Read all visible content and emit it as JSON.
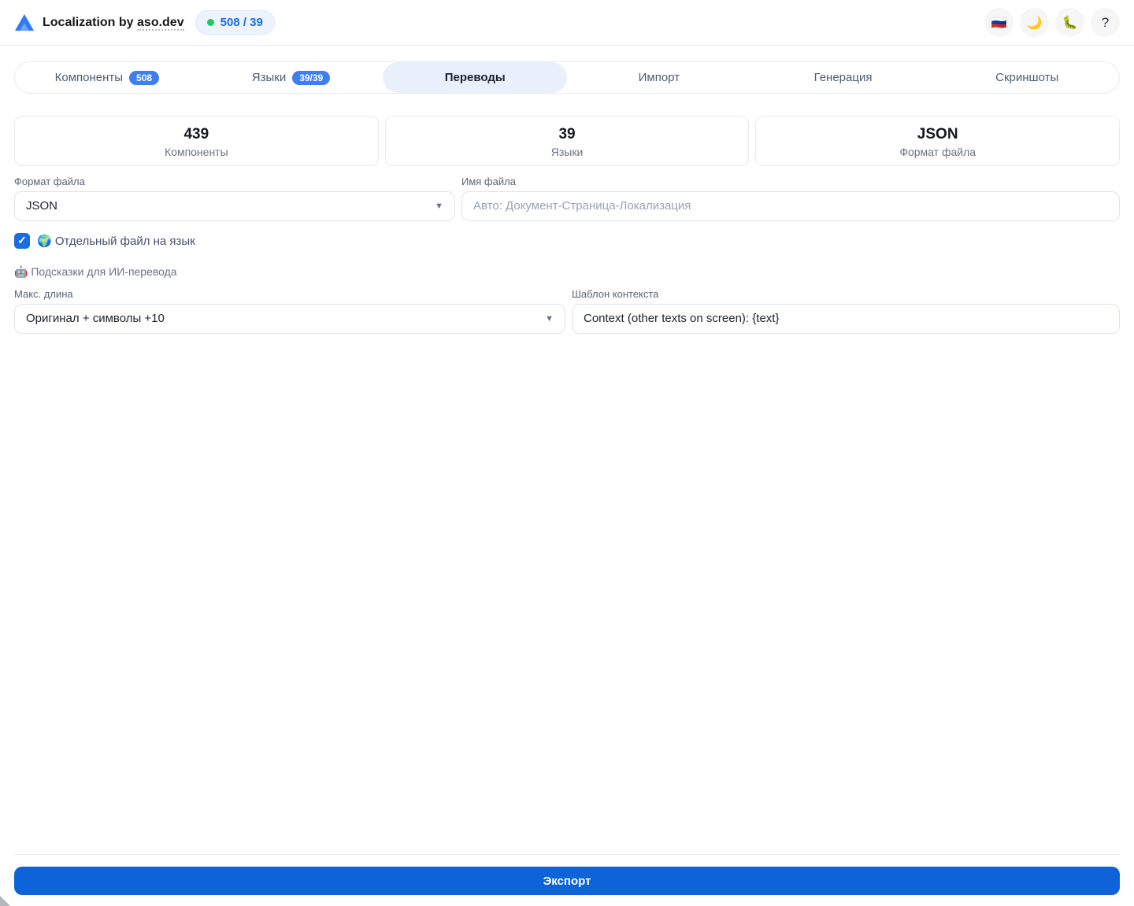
{
  "header": {
    "title_prefix": "Localization by ",
    "title_link": "aso.dev",
    "counter_badge": "508 / 39",
    "actions": {
      "language": "🇷🇺",
      "theme": "🌙",
      "bug": "🐛",
      "help": "?"
    }
  },
  "tabs": [
    {
      "label": "Компоненты",
      "badge": "508"
    },
    {
      "label": "Языки",
      "badge": "39/39"
    },
    {
      "label": "Переводы"
    },
    {
      "label": "Импорт"
    },
    {
      "label": "Генерация"
    },
    {
      "label": "Скриншоты"
    }
  ],
  "stats": [
    {
      "value": "439",
      "label": "Компоненты"
    },
    {
      "value": "39",
      "label": "Языки"
    },
    {
      "value": "JSON",
      "label": "Формат файла"
    }
  ],
  "form": {
    "file_format": {
      "label": "Формат файла",
      "value": "JSON"
    },
    "file_name": {
      "label": "Имя файла",
      "placeholder": "Авто: Документ-Страница-Локализация"
    },
    "separate_file": {
      "label": "🌍 Отдельный файл на язык",
      "checked": true,
      "checkmark": "✓"
    },
    "ai_hints_title": "🤖 Подсказки для ИИ-перевода",
    "max_length": {
      "label": "Макс. длина",
      "value": "Оригинал + символы +10"
    },
    "context_template": {
      "label": "Шаблон контекста",
      "value": "Context (other texts on screen): {text}"
    }
  },
  "footer": {
    "export_label": "Экспорт"
  },
  "colors": {
    "accent_blue": "#0e63d8",
    "badge_text_blue": "#1a6ce0",
    "green_dot": "#22c55e",
    "active_tab_bg": "#e9f0fb"
  }
}
